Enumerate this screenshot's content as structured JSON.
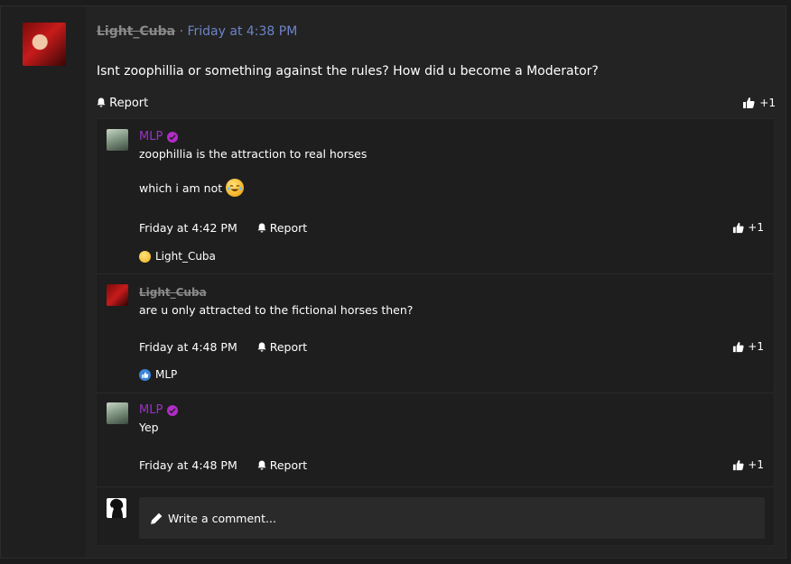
{
  "post": {
    "author": "Light_Cuba",
    "separator": "·",
    "time": "Friday at 4:38 PM",
    "body": "Isnt zoophillia or something against the rules? How did u become a Moderator?",
    "report_label": "Report",
    "like_count": "+1"
  },
  "comments": [
    {
      "author": "MLP",
      "verified": true,
      "line1": "zoophillia is the attraction to real horses",
      "line2": "which i am not",
      "emoji": "face-with-tears-of-joy",
      "time": "Friday at 4:42 PM",
      "report_label": "Report",
      "like_count": "+1",
      "reaction_user": "Light_Cuba",
      "reaction_icon": "laughing-face"
    },
    {
      "author": "Light_Cuba",
      "verified": false,
      "line1": "are u only attracted to the fictional horses then?",
      "time": "Friday at 4:48 PM",
      "report_label": "Report",
      "like_count": "+1",
      "reaction_user": "MLP",
      "reaction_icon": "like"
    },
    {
      "author": "MLP",
      "verified": true,
      "line1": "Yep",
      "time": "Friday at 4:48 PM",
      "report_label": "Report",
      "like_count": "+1"
    }
  ],
  "write_comment": {
    "placeholder": "Write a comment..."
  },
  "colors": {
    "mlp_name": "#9b30c8",
    "time_link": "#6d84c9",
    "verified_badge": "#b22cc8",
    "reaction_like": "#3a86d8"
  }
}
